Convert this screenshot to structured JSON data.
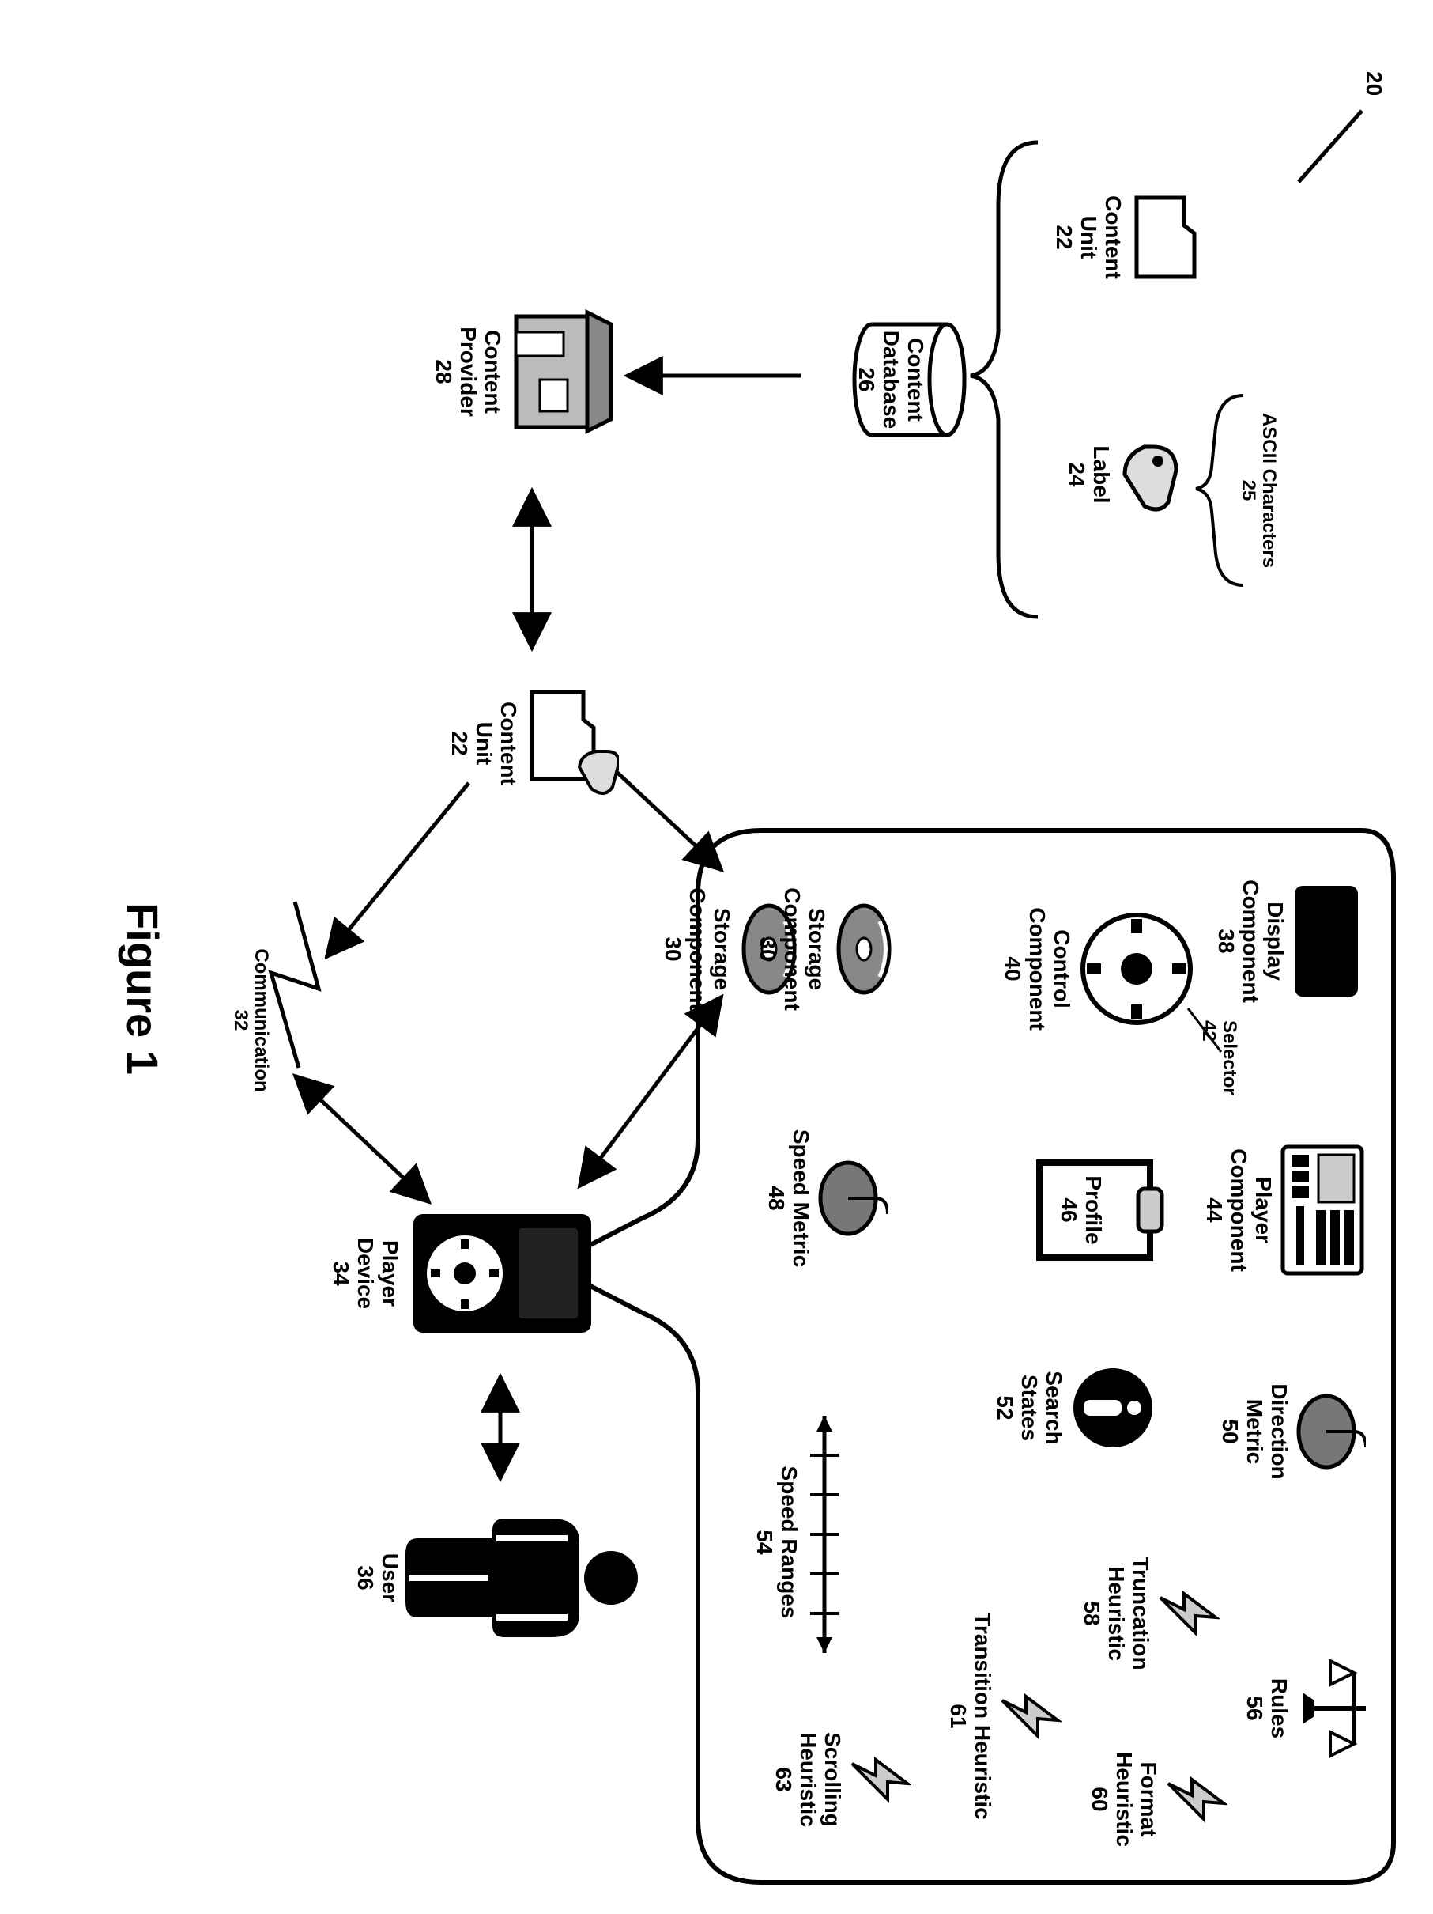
{
  "figure_ref": "20",
  "figure_caption": "Figure 1",
  "nodes": {
    "content_unit": {
      "label": "Content\nUnit",
      "num": "22"
    },
    "label_node": {
      "label": "Label",
      "num": "24"
    },
    "ascii": {
      "label": "ASCII Characters",
      "num": "25"
    },
    "content_db": {
      "label": "Content\nDatabase",
      "num": "26"
    },
    "content_provider": {
      "label": "Content\nProvider",
      "num": "28"
    },
    "content_unit2": {
      "label": "Content\nUnit",
      "num": "22"
    },
    "storage": {
      "label": "Storage\nComponent",
      "num": "30"
    },
    "communication": {
      "label": "Communication",
      "num": "32"
    },
    "player_device": {
      "label": "Player\nDevice",
      "num": "34"
    },
    "user": {
      "label": "User",
      "num": "36"
    },
    "display": {
      "label": "Display\nComponent",
      "num": "38"
    },
    "control": {
      "label": "Control\nComponent",
      "num": "40"
    },
    "selector": {
      "label": "Selector",
      "num": "42"
    },
    "player_comp": {
      "label": "Player\nComponent",
      "num": "44"
    },
    "profile": {
      "label": "Profile",
      "num": "46"
    },
    "speed_metric": {
      "label": "Speed Metric",
      "num": "48"
    },
    "direction": {
      "label": "Direction\nMetric",
      "num": "50"
    },
    "search_states": {
      "label": "Search\nStates",
      "num": "52"
    },
    "speed_ranges": {
      "label": "Speed Ranges",
      "num": "54"
    },
    "rules": {
      "label": "Rules",
      "num": "56"
    },
    "trunc_heur": {
      "label": "Truncation\nHeuristic",
      "num": "58"
    },
    "format_heur": {
      "label": "Format\nHeuristic",
      "num": "60"
    },
    "transition_heur": {
      "label": "Transition Heuristic",
      "num": "61"
    },
    "scrolling_heur": {
      "label": "Scrolling\nHeuristic",
      "num": "63"
    },
    "storage2": {
      "label": "Storage\nComponent",
      "num": "30"
    }
  }
}
